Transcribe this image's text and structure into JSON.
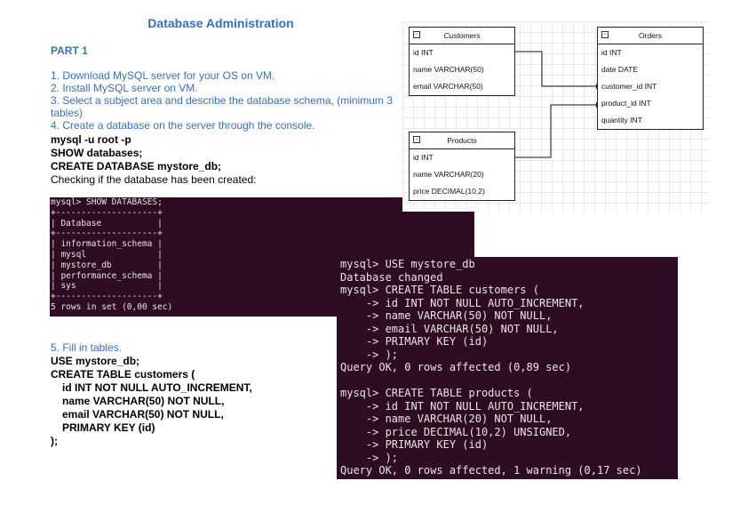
{
  "title": "Database Administration",
  "part": "PART 1",
  "steps": [
    "1. Download MySQL server for your OS on VM.",
    "2. Install MySQL server on VM.",
    "3. Select a subject area and describe the database schema, (minimum 3 tables)",
    "4. Create a database on the server through the console."
  ],
  "commands": {
    "login": "mysql -u root -p",
    "show": "SHOW databases;",
    "create": "CREATE DATABASE mystore_db;",
    "check": "Checking if the database has been created:"
  },
  "terminal1": {
    "lines": [
      "mysql> SHOW DATABASES;",
      "+--------------------+",
      "| Database           |",
      "+--------------------+",
      "| information_schema |",
      "| mysql              |",
      "| mystore_db         |",
      "| performance_schema |",
      "| sys                |",
      "+--------------------+",
      "5 rows in set (0,00 sec)"
    ]
  },
  "section5": {
    "title": "5. Fill in tables.",
    "lines": [
      "USE mystore_db;",
      "CREATE TABLE customers (",
      "id INT NOT NULL AUTO_INCREMENT,",
      "name VARCHAR(50) NOT NULL,",
      "email VARCHAR(50) NOT NULL,",
      "PRIMARY KEY (id)",
      ");"
    ]
  },
  "terminal2": {
    "lines": [
      "mysql> USE mystore_db",
      "Database changed",
      "mysql> CREATE TABLE customers (",
      "    -> id INT NOT NULL AUTO_INCREMENT,",
      "    -> name VARCHAR(50) NOT NULL,",
      "    -> email VARCHAR(50) NOT NULL,",
      "    -> PRIMARY KEY (id)",
      "    -> );",
      "Query OK, 0 rows affected (0,89 sec)",
      "",
      "mysql> CREATE TABLE products (",
      "    -> id INT NOT NULL AUTO_INCREMENT,",
      "    -> name VARCHAR(20) NOT NULL,",
      "    -> price DECIMAL(10,2) UNSIGNED,",
      "    -> PRIMARY KEY (id)",
      "    -> );",
      "Query OK, 0 rows affected, 1 warning (0,17 sec)"
    ]
  },
  "diagram": {
    "customers": {
      "title": "Customers",
      "fields": [
        "id INT",
        "name VARCHAR(50)",
        "email VARCHAR(50)"
      ]
    },
    "orders": {
      "title": "Orders",
      "fields": [
        "id INT",
        "date DATE",
        "customer_id INT",
        "product_id INT",
        "quantity INT"
      ]
    },
    "products": {
      "title": "Products",
      "fields": [
        "id INT",
        "name VARCHAR(20)",
        "price DECIMAL(10,2)"
      ]
    },
    "collapse_glyph": "−"
  }
}
